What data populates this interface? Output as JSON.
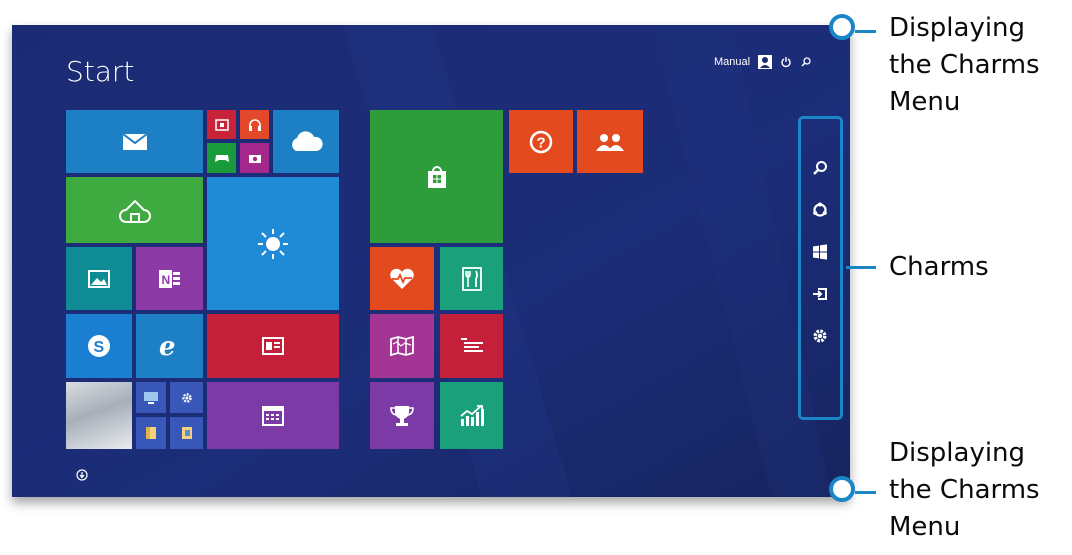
{
  "screen": {
    "title": "Start",
    "user_name": "Manual",
    "icons": {
      "avatar": "user-avatar-icon",
      "power": "power-icon",
      "search": "search-icon",
      "apps_arrow": "arrow-down-circle-icon"
    }
  },
  "tiles": [
    {
      "name": "mail",
      "icon": "mail-icon",
      "color": "#1d7fc4"
    },
    {
      "name": "video",
      "icon": "video-icon",
      "color": "#c7243a"
    },
    {
      "name": "music",
      "icon": "headphones-icon",
      "color": "#e3482b"
    },
    {
      "name": "games",
      "icon": "gamepad-icon",
      "color": "#199a3b"
    },
    {
      "name": "camera",
      "icon": "camera-icon",
      "color": "#a4288c"
    },
    {
      "name": "onedrive",
      "icon": "cloud-icon",
      "color": "#1d7fc4"
    },
    {
      "name": "home",
      "icon": "home-cloud-icon",
      "color": "#3faa3f"
    },
    {
      "name": "weather",
      "icon": "sun-icon",
      "color": "#1f8ad6"
    },
    {
      "name": "photos",
      "icon": "picture-icon",
      "color": "#0f8b96"
    },
    {
      "name": "onenote",
      "icon": "onenote-icon",
      "color": "#8c3aa6"
    },
    {
      "name": "skype",
      "icon": "skype-icon",
      "color": "#1a7fd0"
    },
    {
      "name": "internet-explorer",
      "icon": "ie-icon",
      "color": "#1d7fc4"
    },
    {
      "name": "news",
      "icon": "news-icon",
      "color": "#c4203a"
    },
    {
      "name": "desktop",
      "icon": "desktop-icon",
      "color": "#5c6a7a"
    },
    {
      "name": "computer",
      "icon": "computer-icon",
      "color": "#3957b8"
    },
    {
      "name": "settings",
      "icon": "gear-icon",
      "color": "#3957b8"
    },
    {
      "name": "file-explorer",
      "icon": "folder-icon",
      "color": "#3957b8"
    },
    {
      "name": "documents",
      "icon": "folder-doc-icon",
      "color": "#3957b8"
    },
    {
      "name": "calendar",
      "icon": "calendar-icon",
      "color": "#7b3aa6"
    },
    {
      "name": "store",
      "icon": "shopping-bag-icon",
      "color": "#2e9c3a"
    },
    {
      "name": "help",
      "icon": "question-icon",
      "color": "#e34a1e"
    },
    {
      "name": "people",
      "icon": "people-icon",
      "color": "#e34a1e"
    },
    {
      "name": "health",
      "icon": "heart-rate-icon",
      "color": "#e34a1e"
    },
    {
      "name": "food",
      "icon": "fork-knife-icon",
      "color": "#1aa07a"
    },
    {
      "name": "maps",
      "icon": "map-icon",
      "color": "#a33594"
    },
    {
      "name": "reading-list",
      "icon": "list-icon",
      "color": "#c4203a"
    },
    {
      "name": "sports",
      "icon": "trophy-icon",
      "color": "#7b3aa6"
    },
    {
      "name": "finance",
      "icon": "chart-icon",
      "color": "#1aa07a"
    }
  ],
  "charms": [
    {
      "name": "search",
      "icon": "search-icon"
    },
    {
      "name": "share",
      "icon": "share-icon"
    },
    {
      "name": "start",
      "icon": "windows-icon"
    },
    {
      "name": "devices",
      "icon": "devices-icon"
    },
    {
      "name": "settings",
      "icon": "gear-icon"
    }
  ],
  "annotations": {
    "top": [
      "Displaying",
      "the Charms",
      "Menu"
    ],
    "middle": "Charms",
    "bottom": [
      "Displaying",
      "the Charms",
      "Menu"
    ],
    "accent_color": "#1a86c8"
  }
}
